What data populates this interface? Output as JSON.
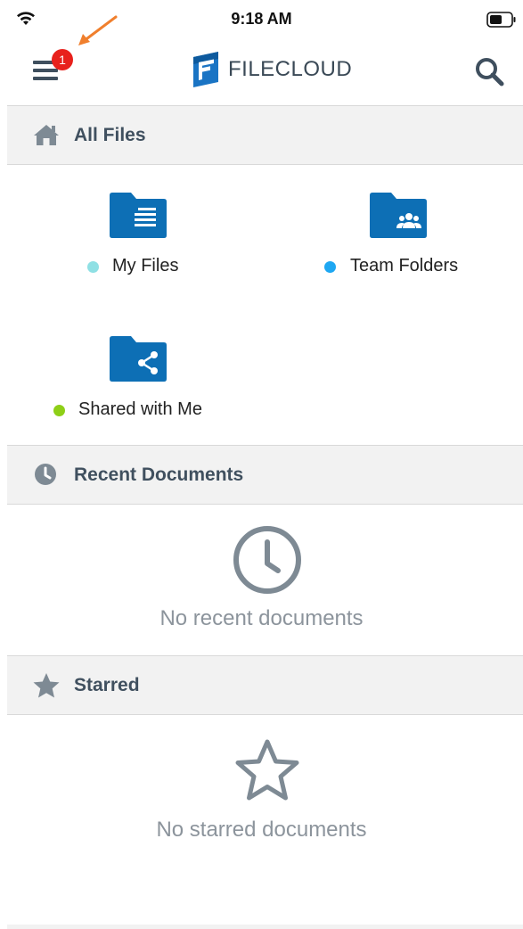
{
  "status_bar": {
    "time": "9:18 AM"
  },
  "header": {
    "menu_badge_count": "1",
    "logo_text": "FILECLOUD"
  },
  "all_files": {
    "title": "All Files",
    "folders": [
      {
        "label": "My Files",
        "dot_color": "#8fe0e4"
      },
      {
        "label": "Team Folders",
        "dot_color": "#1ea7f2"
      },
      {
        "label": "Shared with Me",
        "dot_color": "#8ecf17"
      }
    ]
  },
  "recent": {
    "title": "Recent Documents",
    "empty_text": "No recent documents"
  },
  "starred": {
    "title": "Starred",
    "empty_text": "No starred documents"
  },
  "colors": {
    "folder_blue": "#0d6fb5",
    "section_bg": "#f2f2f2",
    "badge_red": "#e8211c",
    "annotation_arrow": "#f07f2d"
  }
}
